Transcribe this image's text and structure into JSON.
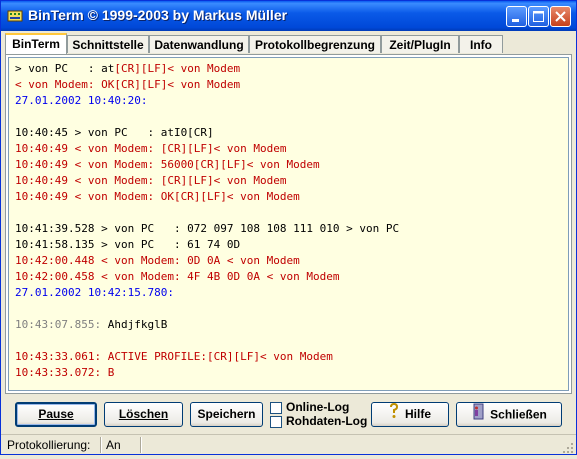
{
  "window": {
    "title": "BinTerm © 1999-2003 by Markus Müller"
  },
  "tabs": [
    {
      "label": "BinTerm",
      "active": true
    },
    {
      "label": "Schnittstelle"
    },
    {
      "label": "Datenwandlung"
    },
    {
      "label": "Protokollbegrenzung"
    },
    {
      "label": "Zeit/PlugIn"
    },
    {
      "label": "Info"
    }
  ],
  "log": {
    "lines": [
      {
        "text": "> von PC   : at",
        "extra": "[CR][LF]< von Modem",
        "color": "black",
        "extra_color": "red"
      },
      {
        "text": "< von Modem: OK[CR][LF]< von Modem",
        "color": "red"
      },
      {
        "text": "27.01.2002 10:40:20:",
        "color": "blue"
      },
      {
        "text": "",
        "color": "black"
      },
      {
        "text": "10:40:45 > von PC   : atI0[CR]",
        "color": "black"
      },
      {
        "text": "10:40:49 < von Modem: [CR][LF]< von Modem",
        "color": "red"
      },
      {
        "text": "10:40:49 < von Modem: 56000[CR][LF]< von Modem",
        "color": "red"
      },
      {
        "text": "10:40:49 < von Modem: [CR][LF]< von Modem",
        "color": "red"
      },
      {
        "text": "10:40:49 < von Modem: OK[CR][LF]< von Modem",
        "color": "red"
      },
      {
        "text": "",
        "color": "black"
      },
      {
        "text": "10:41:39.528 > von PC   : 072 097 108 108 111 010 > von PC",
        "color": "black"
      },
      {
        "text": "10:41:58.135 > von PC   : 61 74 0D",
        "color": "black"
      },
      {
        "text": "10:42:00.448 < von Modem: 0D 0A < von Modem",
        "color": "red"
      },
      {
        "text": "10:42:00.458 < von Modem: 4F 4B 0D 0A < von Modem",
        "color": "red"
      },
      {
        "text": "27.01.2002 10:42:15.780:",
        "color": "blue"
      },
      {
        "text": "",
        "color": "black"
      },
      {
        "text": "10:43:07.855: ",
        "extra": "AhdjfkglB",
        "color": "gray",
        "extra_color": "black"
      },
      {
        "text": "",
        "color": "black"
      },
      {
        "text": "10:43:33.061: ACTIVE PROFILE:[CR][LF]< von Modem",
        "color": "red"
      },
      {
        "text": "10:43:33.072: B",
        "color": "red"
      }
    ]
  },
  "toolbar": {
    "pause": "Pause",
    "loeschen": "Löschen",
    "speichern": "Speichern",
    "online_log": "Online-Log",
    "rohdaten_log": "Rohdaten-Log",
    "hilfe": "Hilfe",
    "schliessen": "Schließen"
  },
  "status": {
    "label": "Protokollierung:",
    "value": "An"
  },
  "colors": {
    "log_background": "#ffffe1",
    "log_red": "#c00000",
    "log_blue": "#0000ee",
    "titlebar": "#0a5ae8"
  }
}
